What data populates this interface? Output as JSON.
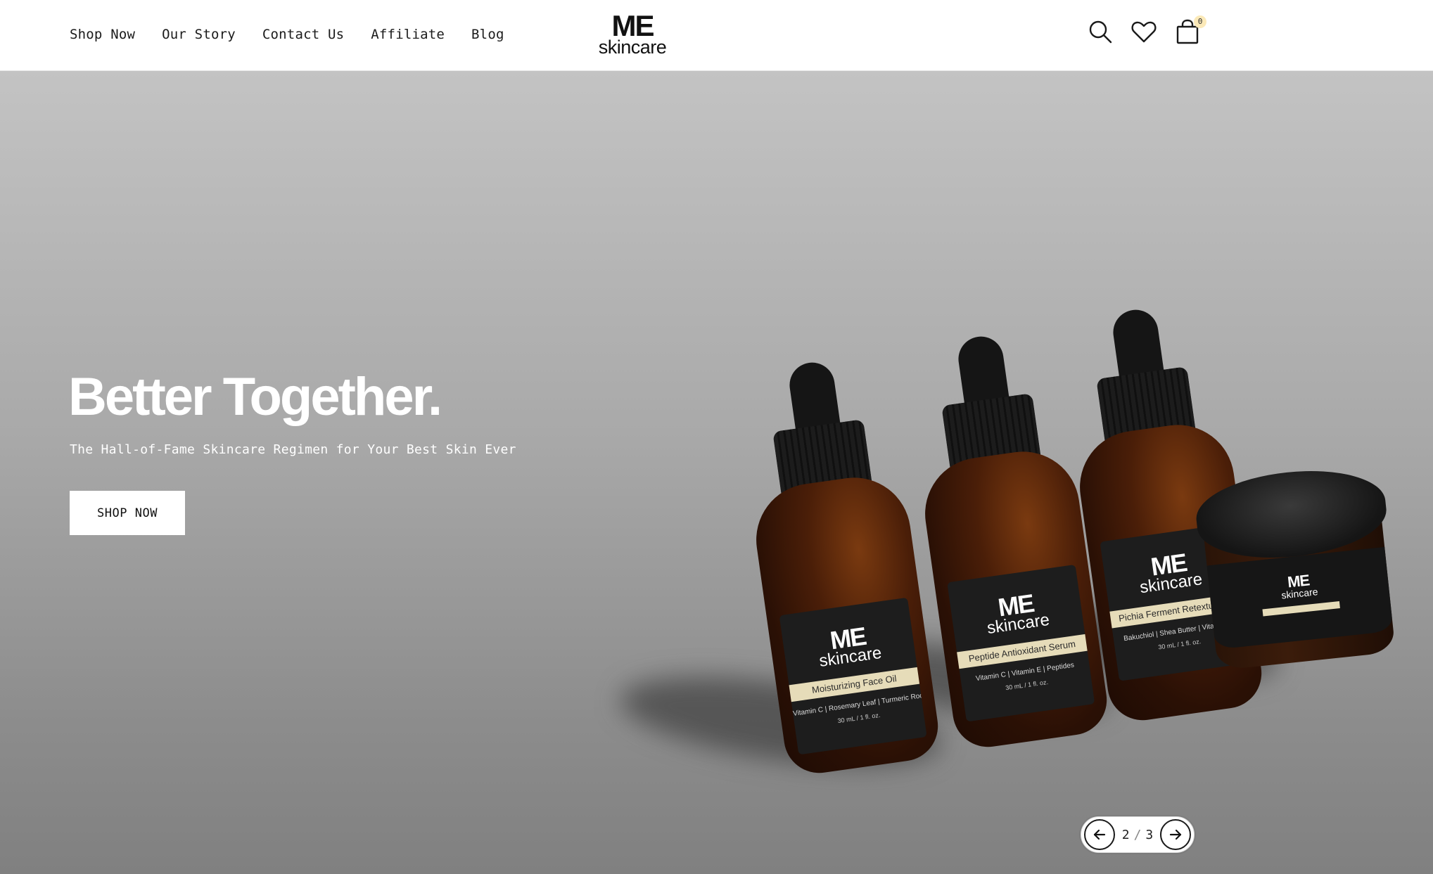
{
  "brand": {
    "logo_mark": "ME",
    "logo_word": "skincare"
  },
  "nav": {
    "items": [
      {
        "label": "Shop Now"
      },
      {
        "label": "Our Story"
      },
      {
        "label": "Contact Us"
      },
      {
        "label": "Affiliate"
      },
      {
        "label": "Blog"
      }
    ]
  },
  "header_icons": {
    "search": "search-icon",
    "wishlist": "heart-icon",
    "cart": "shopping-bag-icon",
    "cart_count": "0"
  },
  "hero": {
    "title": "Better Together.",
    "subtitle": "The Hall-of-Fame Skincare Regimen for Your Best Skin Ever",
    "cta_label": "SHOP NOW",
    "products": [
      {
        "mark": "ME",
        "word": "skincare",
        "name": "Moisturizing Face Oil",
        "ingredients": "Vitamin C | Rosemary Leaf | Turmeric Root",
        "volume": "30 mL / 1 fl. oz."
      },
      {
        "mark": "ME",
        "word": "skincare",
        "name": "Peptide Antioxidant Serum",
        "ingredients": "Vitamin C | Vitamin E | Peptides",
        "volume": "30 mL / 1 fl. oz."
      },
      {
        "mark": "ME",
        "word": "skincare",
        "name": "Pichia Ferment Retexturizer",
        "ingredients": "Bakuchiol | Shea Butter | Vitamin E",
        "volume": "30 mL / 1 fl. oz."
      }
    ],
    "jar": {
      "mark": "ME",
      "word": "skincare"
    }
  },
  "slider": {
    "current": "2",
    "separator": "/",
    "total": "3",
    "prev_icon": "arrow-left-icon",
    "next_icon": "arrow-right-icon"
  },
  "colors": {
    "header_bg": "#ffffff",
    "hero_top": "#c3c3c3",
    "hero_bottom": "#808080",
    "text_light": "#ffffff",
    "badge": "#fbe9b8"
  }
}
